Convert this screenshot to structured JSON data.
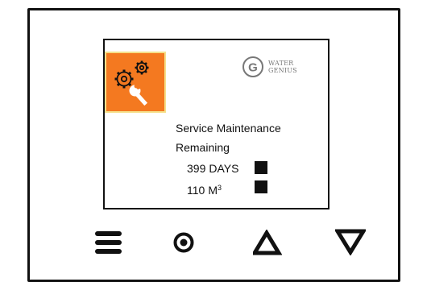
{
  "screen": {
    "service_icon": "gears-wrench-icon",
    "brand": {
      "mark_letter": "G",
      "word_line1": "WATER",
      "word_line2": "GENIUS"
    },
    "message_line1": "Service Maintenance",
    "message_line2": "Remaining",
    "days": {
      "value": "399",
      "unit": "DAYS"
    },
    "volume": {
      "value": "110",
      "unit": "M",
      "unit_sup": "3"
    }
  },
  "controls": [
    {
      "name": "menu-button",
      "icon": "hamburger-menu-icon"
    },
    {
      "name": "select-button",
      "icon": "circle-dot-icon"
    },
    {
      "name": "up-button",
      "icon": "triangle-up-icon"
    },
    {
      "name": "down-button",
      "icon": "triangle-down-icon"
    }
  ],
  "colors": {
    "service_tile": "#F47920",
    "tile_border": "#F5E08A",
    "frame": "#111111"
  }
}
